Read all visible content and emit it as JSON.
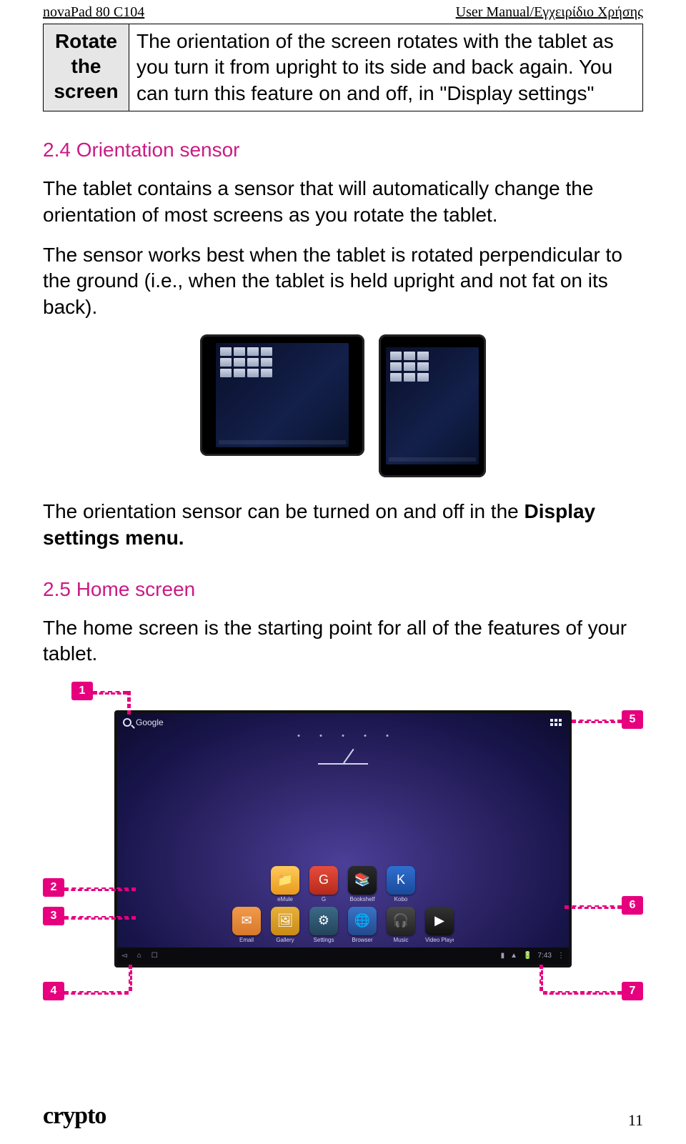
{
  "header": {
    "left": "novaPad 80 C104",
    "right": "User Manual/Εγχειρίδιο Χρήσης"
  },
  "table": {
    "label_l1": "Rotate",
    "label_l2": "the",
    "label_l3": "screen",
    "desc": "The orientation of the screen rotates with the tablet as you turn it from upright to its side and back again. You can turn this feature on and off, in \"Display settings\""
  },
  "sec24": {
    "title": "2.4 Orientation sensor",
    "p1": "The tablet contains a sensor that will automatically change the orientation of most screens as you rotate the tablet.",
    "p2": "The sensor works best when the tablet is rotated perpendicular to the ground (i.e., when the tablet is held upright and not fat on its back).",
    "p3a": "The orientation sensor can be turned on and off in the ",
    "p3b": "Display settings menu."
  },
  "sec25": {
    "title": "2.5 Home screen",
    "p1": "The home screen is the starting point for all of the features of your tablet."
  },
  "home": {
    "search_label": "Google",
    "icons_row1": [
      "eMule",
      "G",
      "Bookshelf",
      "Kobo"
    ],
    "icons_row2": [
      "Email",
      "Gallery",
      "Settings",
      "Browser",
      "Music",
      "Video Player"
    ],
    "time": "7:43"
  },
  "callouts": {
    "c1": "1",
    "c2": "2",
    "c3": "3",
    "c4": "4",
    "c5": "5",
    "c6": "6",
    "c7": "7"
  },
  "footer": {
    "brand": "crypto",
    "page": "11"
  }
}
